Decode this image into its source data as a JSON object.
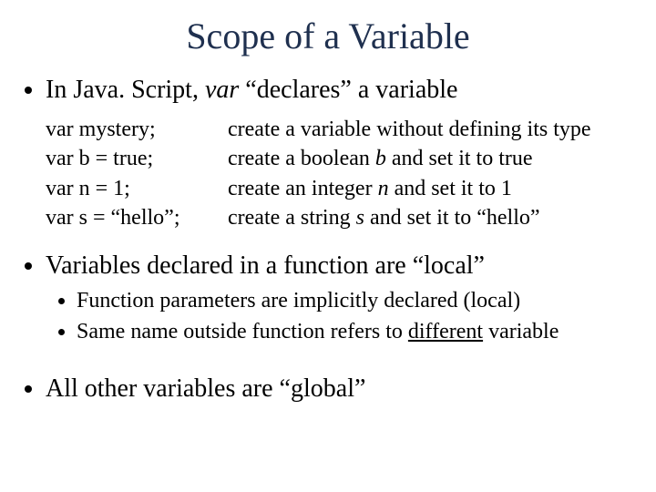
{
  "title": "Scope of a Variable",
  "bullets": {
    "b1_pre": "In Java. Script, ",
    "b1_var": "var",
    "b1_post": " “declares” a variable",
    "b2": "Variables declared in a function are “local”",
    "b2_sub1": "Function parameters are implicitly declared (local)",
    "b2_sub2_pre": "Same name outside function refers to ",
    "b2_sub2_u": "different",
    "b2_sub2_post": " variable",
    "b3": "All other variables are “global”"
  },
  "code": {
    "r1_code": "var mystery;",
    "r1_desc": "create a variable without defining its type",
    "r2_code": "var b = true;",
    "r2_desc_pre": "create a boolean ",
    "r2_desc_i": "b",
    "r2_desc_post": " and set it to true",
    "r3_code": "var n = 1;",
    "r3_desc_pre": "create an integer ",
    "r3_desc_i": "n",
    "r3_desc_post": " and set it to 1",
    "r4_code": "var s = “hello”;",
    "r4_desc_pre": "create a string ",
    "r4_desc_i": "s",
    "r4_desc_post": " and set it to “hello”"
  }
}
